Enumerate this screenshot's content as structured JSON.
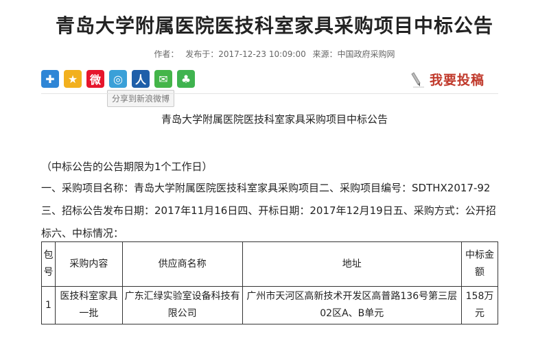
{
  "article": {
    "title": "青岛大学附属医院医技科室家具采购项目中标公告",
    "meta": {
      "author_label": "作者：",
      "published": "发布于：2017-12-23 10:09:00",
      "source": "来源：中国政府采购网"
    },
    "subtitle": "青岛大学附属医院医技科室家具采购项目中标公告",
    "notice": "（中标公告的公告期限为1个工作日）",
    "body": "一、采购项目名称：青岛大学附属医院医技科室家具采购项目二、采购项目编号：SDTHX2017-92三、招标公告发布日期：2017年11月16日四、开标日期：2017年12月19日五、采购方式：公开招标六、中标情况："
  },
  "share": {
    "icons": [
      {
        "name": "share-more-icon",
        "glyph": "✚",
        "color": "#2f86d6"
      },
      {
        "name": "qzone-icon",
        "glyph": "★",
        "color": "#f2b01e"
      },
      {
        "name": "weibo-icon",
        "glyph": "微",
        "color": "#e6162d"
      },
      {
        "name": "tencent-weibo-icon",
        "glyph": "◎",
        "color": "#3aa0d8"
      },
      {
        "name": "renren-icon",
        "glyph": "人",
        "color": "#1f5fa9"
      },
      {
        "name": "wechat-icon",
        "glyph": "✉",
        "color": "#44b549"
      },
      {
        "name": "kaixin-icon",
        "glyph": "♣",
        "color": "#3fb34f"
      }
    ],
    "tooltip": "分享到新浪微博"
  },
  "contribute": {
    "label": "我要投稿",
    "icon": "pencil-icon"
  },
  "table": {
    "headers": [
      "包号",
      "采购内容",
      "供应商名称",
      "地址",
      "中标金额"
    ],
    "rows": [
      [
        "1",
        "医技科室家具一批",
        "广东汇绿实验室设备科技有限公司",
        "广州市天河区高新技术开发区高普路136号第三层02区A、B单元",
        "158万元"
      ]
    ]
  }
}
